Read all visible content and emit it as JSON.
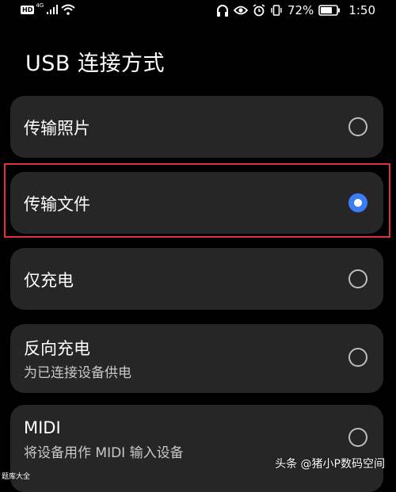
{
  "status_bar": {
    "hd": "HD",
    "network": "4G",
    "battery_percent": "72%",
    "time": "1:50",
    "icons": [
      "signal-icon",
      "wifi-icon",
      "headphones-icon",
      "eye-icon",
      "alarm-icon",
      "vibrate-icon",
      "battery-icon"
    ]
  },
  "page": {
    "title": "USB 连接方式"
  },
  "options": [
    {
      "label": "传输照片",
      "subtitle": "",
      "selected": false
    },
    {
      "label": "传输文件",
      "subtitle": "",
      "selected": true
    },
    {
      "label": "仅充电",
      "subtitle": "",
      "selected": false
    },
    {
      "label": "反向充电",
      "subtitle": "为已连接设备供电",
      "selected": false
    },
    {
      "label": "MIDI",
      "subtitle": "将设备用作 MIDI 输入设备",
      "selected": false
    }
  ],
  "watermarks": {
    "left": "题库大全",
    "right": "头条 @猪小P数码空间"
  },
  "colors": {
    "accent": "#3d7bf5",
    "card": "#262626",
    "highlight": "#e0313b"
  }
}
